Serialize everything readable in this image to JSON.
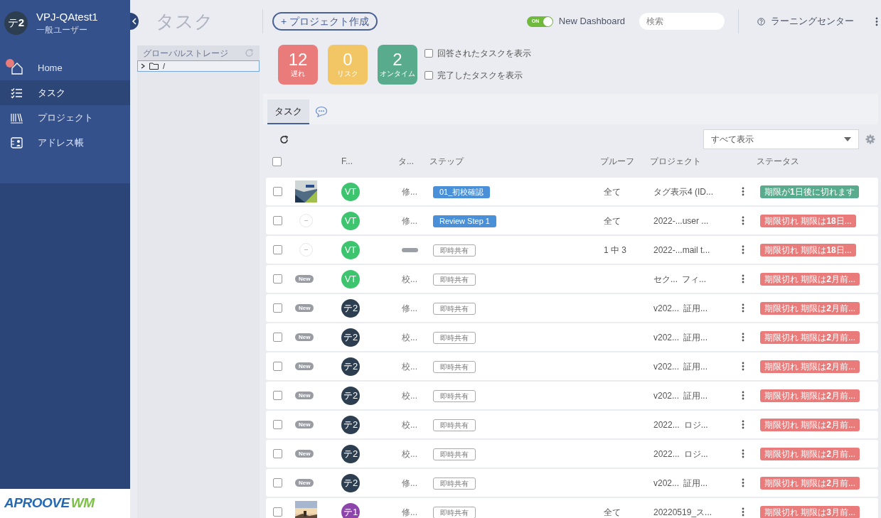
{
  "sidebar": {
    "user": {
      "avatar": "テ**2**",
      "name": "VPJ-QAtest1",
      "role": "一般ユーザー"
    },
    "items": [
      {
        "label": "Home",
        "selected": false,
        "notification": true
      },
      {
        "label": "タスク",
        "selected": true,
        "notification": false
      },
      {
        "label": "プロジェクト",
        "selected": false,
        "notification": false
      },
      {
        "label": "アドレス帳",
        "selected": false,
        "notification": false
      }
    ],
    "logo": [
      "APROOVE",
      "WM"
    ]
  },
  "header": {
    "title": "タスク",
    "create_button": "+ プロジェクト作成",
    "toggle": {
      "on": true,
      "label": "ON",
      "text": "New Dashboard"
    },
    "search": {
      "placeholder": "検索"
    },
    "learning": "ラーニングセンター"
  },
  "storage": {
    "title": "グローバルストレージ",
    "root": "/"
  },
  "summary": [
    {
      "count": "12",
      "label": "遅れ",
      "color": "#e97b7b"
    },
    {
      "count": "0",
      "label": "リスク",
      "color": "#f2c665"
    },
    {
      "count": "2",
      "label": "オンタイム",
      "color": "#58ab8c"
    }
  ],
  "filters": [
    {
      "label": "回答されたタスクを表示",
      "checked": false
    },
    {
      "label": "完了したタスクを表示",
      "checked": false
    }
  ],
  "tabs": [
    {
      "label": "タスク",
      "kind": "text",
      "selected": true
    },
    {
      "kind": "chat",
      "selected": false
    }
  ],
  "view_select": "すべて表示",
  "table": {
    "select_all_checked": false,
    "columns": [
      "F...",
      "タ...",
      "ステップ",
      "プルーフ",
      "プロジェクト",
      "ステータス"
    ],
    "rows": [
      {
        "checked": false,
        "thumb": {
          "kind": "picture"
        },
        "avatar": {
          "text": "VT",
          "color": "#3cc46e"
        },
        "type": {
          "kind": "text",
          "label": "修..."
        },
        "step": {
          "kind": "filled",
          "label": "01_初校確認"
        },
        "proof": "全て",
        "project": [
          "タグ表示4 (ID..."
        ],
        "status": {
          "label": "期限が**1**日後に切れます",
          "color": "#58ab8c"
        }
      },
      {
        "checked": false,
        "thumb": {
          "kind": "placeholder"
        },
        "avatar": {
          "text": "VT",
          "color": "#3cc46e"
        },
        "type": {
          "kind": "text",
          "label": "修..."
        },
        "step": {
          "kind": "filled",
          "label": "Review Step 1"
        },
        "proof": "全て",
        "project": [
          "2022-...user ..."
        ],
        "status": {
          "label": "期限切れ 期限は**18**日...",
          "color": "#e97b7b"
        }
      },
      {
        "checked": false,
        "thumb": {
          "kind": "placeholder"
        },
        "avatar": {
          "text": "VT",
          "color": "#3cc46e"
        },
        "type": {
          "kind": "tag"
        },
        "step": {
          "kind": "outline",
          "label": "即時共有"
        },
        "proof": "1 中 3",
        "project": [
          "2022-...mail t..."
        ],
        "status": {
          "label": "期限切れ 期限は**18**日...",
          "color": "#e97b7b"
        }
      },
      {
        "checked": false,
        "thumb": {
          "kind": "badge",
          "label": "New"
        },
        "avatar": {
          "text": "VT",
          "color": "#3cc46e"
        },
        "type": {
          "kind": "text",
          "label": "校..."
        },
        "step": {
          "kind": "outline",
          "label": "即時共有"
        },
        "project": [
          "セク...",
          "フィ..."
        ],
        "status": {
          "label": "期限切れ 期限は**2**月前...",
          "color": "#e97b7b"
        }
      },
      {
        "checked": false,
        "thumb": {
          "kind": "badge",
          "label": "New"
        },
        "avatar": {
          "text": "テ2",
          "color": "#2c3e50"
        },
        "type": {
          "kind": "text",
          "label": "修..."
        },
        "step": {
          "kind": "outline",
          "label": "即時共有"
        },
        "project": [
          "v202...",
          "証用..."
        ],
        "status": {
          "label": "期限切れ 期限は**2**月前...",
          "color": "#e97b7b"
        }
      },
      {
        "checked": false,
        "thumb": {
          "kind": "badge",
          "label": "New"
        },
        "avatar": {
          "text": "テ2",
          "color": "#2c3e50"
        },
        "type": {
          "kind": "text",
          "label": "校..."
        },
        "step": {
          "kind": "outline",
          "label": "即時共有"
        },
        "project": [
          "v202...",
          "証用..."
        ],
        "status": {
          "label": "期限切れ 期限は**2**月前...",
          "color": "#e97b7b"
        }
      },
      {
        "checked": false,
        "thumb": {
          "kind": "badge",
          "label": "New"
        },
        "avatar": {
          "text": "テ2",
          "color": "#2c3e50"
        },
        "type": {
          "kind": "text",
          "label": "校..."
        },
        "step": {
          "kind": "outline",
          "label": "即時共有"
        },
        "project": [
          "v202...",
          "証用..."
        ],
        "status": {
          "label": "期限切れ 期限は**2**月前...",
          "color": "#e97b7b"
        }
      },
      {
        "checked": false,
        "thumb": {
          "kind": "badge",
          "label": "New"
        },
        "avatar": {
          "text": "テ2",
          "color": "#2c3e50"
        },
        "type": {
          "kind": "text",
          "label": "校..."
        },
        "step": {
          "kind": "outline",
          "label": "即時共有"
        },
        "project": [
          "v202...",
          "証用..."
        ],
        "status": {
          "label": "期限切れ 期限は**2**月前...",
          "color": "#e97b7b"
        }
      },
      {
        "checked": false,
        "thumb": {
          "kind": "badge",
          "label": "New"
        },
        "avatar": {
          "text": "テ2",
          "color": "#2c3e50"
        },
        "type": {
          "kind": "text",
          "label": "校..."
        },
        "step": {
          "kind": "outline",
          "label": "即時共有"
        },
        "project": [
          "2022...",
          "ロジ..."
        ],
        "status": {
          "label": "期限切れ 期限は**2**月前...",
          "color": "#e97b7b"
        }
      },
      {
        "checked": false,
        "thumb": {
          "kind": "badge",
          "label": "New"
        },
        "avatar": {
          "text": "テ2",
          "color": "#2c3e50"
        },
        "type": {
          "kind": "text",
          "label": "校..."
        },
        "step": {
          "kind": "outline",
          "label": "即時共有"
        },
        "project": [
          "2022...",
          "ロジ..."
        ],
        "status": {
          "label": "期限切れ 期限は**2**月前...",
          "color": "#e97b7b"
        }
      },
      {
        "checked": false,
        "thumb": {
          "kind": "badge",
          "label": "New"
        },
        "avatar": {
          "text": "テ2",
          "color": "#2c3e50"
        },
        "type": {
          "kind": "text",
          "label": "修..."
        },
        "step": {
          "kind": "outline",
          "label": "即時共有"
        },
        "project": [
          "v202...",
          "証用..."
        ],
        "status": {
          "label": "期限切れ 期限は**2**月前...",
          "color": "#e97b7b"
        }
      },
      {
        "checked": false,
        "thumb": {
          "kind": "picture"
        },
        "avatar": {
          "text": "テ1",
          "color": "#8e44ad"
        },
        "type": {
          "kind": "text",
          "label": "修..."
        },
        "step": {
          "kind": "outline",
          "label": "即時共有"
        },
        "proof": "全て",
        "project": [
          "20220519_ス..."
        ],
        "status": {
          "label": "期限切れ 期限は**3**月前...",
          "color": "#e97b7b"
        }
      }
    ]
  }
}
